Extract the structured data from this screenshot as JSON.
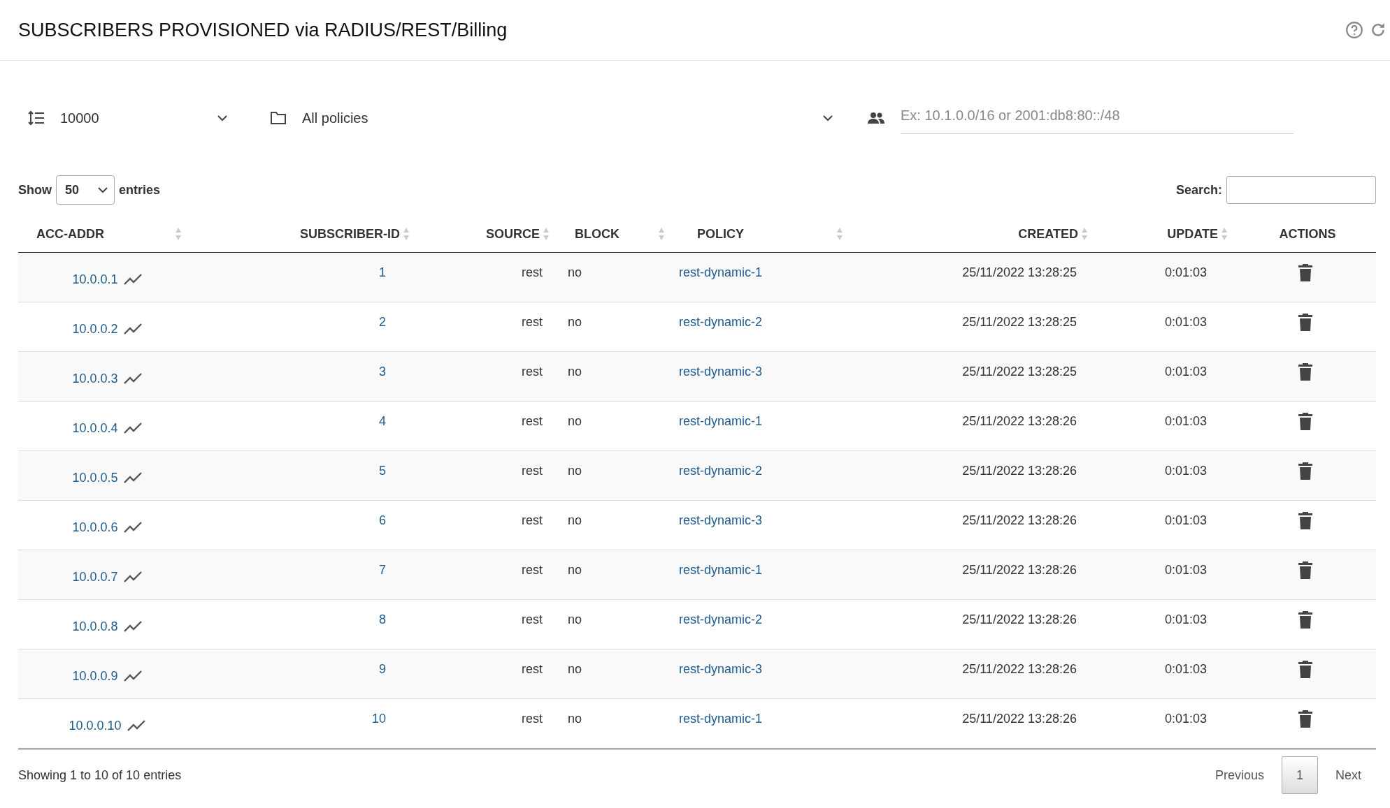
{
  "header": {
    "title": "SUBSCRIBERS PROVISIONED via RADIUS/REST/Billing"
  },
  "filters": {
    "limit": "10000",
    "policy": "All policies",
    "subnet_placeholder": "Ex: 10.1.0.0/16 or 2001:db8:80::/48"
  },
  "length_control": {
    "show": "Show",
    "value": "50",
    "entries": "entries"
  },
  "search": {
    "label": "Search:"
  },
  "table": {
    "columns": [
      {
        "label": "ACC-ADDR",
        "sortable": true
      },
      {
        "label": "SUBSCRIBER-ID",
        "sortable": true
      },
      {
        "label": "SOURCE",
        "sortable": true
      },
      {
        "label": "BLOCK",
        "sortable": true
      },
      {
        "label": "POLICY",
        "sortable": true
      },
      {
        "label": "CREATED",
        "sortable": true
      },
      {
        "label": "UPDATE",
        "sortable": true
      },
      {
        "label": "ACTIONS",
        "sortable": false
      }
    ],
    "rows": [
      {
        "addr": "10.0.0.1",
        "id": "1",
        "source": "rest",
        "block": "no",
        "policy": "rest-dynamic-1",
        "created": "25/11/2022 13:28:25",
        "update": "0:01:03"
      },
      {
        "addr": "10.0.0.2",
        "id": "2",
        "source": "rest",
        "block": "no",
        "policy": "rest-dynamic-2",
        "created": "25/11/2022 13:28:25",
        "update": "0:01:03"
      },
      {
        "addr": "10.0.0.3",
        "id": "3",
        "source": "rest",
        "block": "no",
        "policy": "rest-dynamic-3",
        "created": "25/11/2022 13:28:25",
        "update": "0:01:03"
      },
      {
        "addr": "10.0.0.4",
        "id": "4",
        "source": "rest",
        "block": "no",
        "policy": "rest-dynamic-1",
        "created": "25/11/2022 13:28:26",
        "update": "0:01:03"
      },
      {
        "addr": "10.0.0.5",
        "id": "5",
        "source": "rest",
        "block": "no",
        "policy": "rest-dynamic-2",
        "created": "25/11/2022 13:28:26",
        "update": "0:01:03"
      },
      {
        "addr": "10.0.0.6",
        "id": "6",
        "source": "rest",
        "block": "no",
        "policy": "rest-dynamic-3",
        "created": "25/11/2022 13:28:26",
        "update": "0:01:03"
      },
      {
        "addr": "10.0.0.7",
        "id": "7",
        "source": "rest",
        "block": "no",
        "policy": "rest-dynamic-1",
        "created": "25/11/2022 13:28:26",
        "update": "0:01:03"
      },
      {
        "addr": "10.0.0.8",
        "id": "8",
        "source": "rest",
        "block": "no",
        "policy": "rest-dynamic-2",
        "created": "25/11/2022 13:28:26",
        "update": "0:01:03"
      },
      {
        "addr": "10.0.0.9",
        "id": "9",
        "source": "rest",
        "block": "no",
        "policy": "rest-dynamic-3",
        "created": "25/11/2022 13:28:26",
        "update": "0:01:03"
      },
      {
        "addr": "10.0.0.10",
        "id": "10",
        "source": "rest",
        "block": "no",
        "policy": "rest-dynamic-1",
        "created": "25/11/2022 13:28:26",
        "update": "0:01:03"
      }
    ]
  },
  "footer": {
    "info": "Showing 1 to 10 of 10 entries",
    "previous": "Previous",
    "pages": [
      {
        "label": "1",
        "selected": true
      }
    ],
    "next": "Next"
  }
}
